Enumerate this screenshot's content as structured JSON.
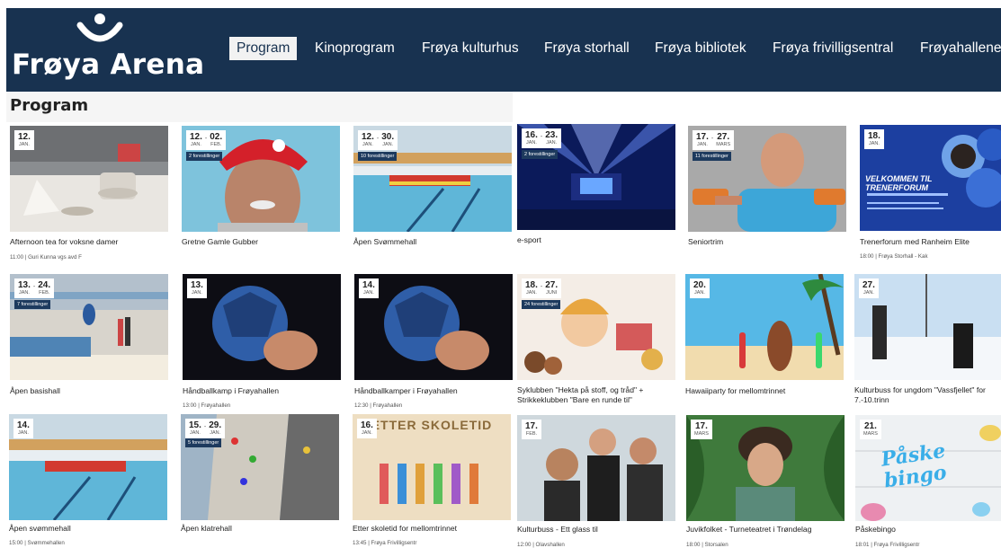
{
  "brand": {
    "name": "Frøya Arena"
  },
  "nav": {
    "items": [
      "Program",
      "Kinoprogram",
      "Frøya kulturhus",
      "Frøya storhall",
      "Frøya bibliotek",
      "Frøya frivilligsentral",
      "Frøyahallene"
    ],
    "active": "Program"
  },
  "page": {
    "title": "Program"
  },
  "colors": {
    "header": "#183250",
    "badge": "#1d3a5e"
  },
  "events": [
    {
      "d1": "12.",
      "m1": "JAN.",
      "title": "Afternoon tea for voksne damer",
      "meta": "11:00  |  Guri Kunna vgs avd F"
    },
    {
      "d1": "12.",
      "m1": "JAN.",
      "d2": "02.",
      "m2": "FEB.",
      "badge": "2 forestillinger",
      "title": "Gretne Gamle Gubber"
    },
    {
      "d1": "12.",
      "m1": "JAN.",
      "d2": "30.",
      "m2": "JAN.",
      "badge": "10 forestillinger",
      "title": "Åpen Svømmehall"
    },
    {
      "d1": "16.",
      "m1": "JAN.",
      "d2": "23.",
      "m2": "JAN.",
      "badge": "2 forestillinger",
      "title": "e-sport"
    },
    {
      "d1": "17.",
      "m1": "JAN.",
      "d2": "27.",
      "m2": "MARS",
      "badge": "11 forestillinger",
      "title": "Seniortrim"
    },
    {
      "d1": "18.",
      "m1": "JAN.",
      "title": "Trenerforum med Ranheim Elite",
      "meta": "18:00  |  Frøya Storhall - Kak",
      "poster": "VELKOMMEN TIL TRENERFORUM"
    },
    {
      "d1": "13.",
      "m1": "JAN.",
      "d2": "24.",
      "m2": "FEB.",
      "badge": "7 forestillinger",
      "title": "Åpen basishall"
    },
    {
      "d1": "13.",
      "m1": "JAN.",
      "title": "Håndballkamp i Frøyahallen",
      "meta": "13:00  |  Frøyahallen"
    },
    {
      "d1": "14.",
      "m1": "JAN.",
      "title": "Håndballkamper i Frøyahallen",
      "meta": "12:30  |  Frøyahallen"
    },
    {
      "d1": "18.",
      "m1": "JAN.",
      "d2": "27.",
      "m2": "JUNI",
      "badge": "24 forestillinger",
      "title": "Syklubben \"Hekta på stoff, og tråd\" + Strikkeklubben \"Bare en runde til\""
    },
    {
      "d1": "20.",
      "m1": "JAN.",
      "title": "Hawaiiparty for mellomtrinnet"
    },
    {
      "d1": "27.",
      "m1": "JAN.",
      "title": "Kulturbuss for ungdom \"Vassfjellet\" for 7.-10.trinn"
    },
    {
      "d1": "14.",
      "m1": "JAN.",
      "title": "Åpen svømmehall",
      "meta": "15:00  |  Svømmehallen"
    },
    {
      "d1": "15.",
      "m1": "JAN.",
      "d2": "29.",
      "m2": "JAN.",
      "badge": "5 forestillinger",
      "title": "Åpen klatrehall"
    },
    {
      "d1": "16.",
      "m1": "JAN.",
      "title": "Etter skoletid for mellomtrinnet",
      "meta": "13:45  |  Frøya Frivilligsentr",
      "poster": "ETTER SKOLETID"
    },
    {
      "d1": "17.",
      "m1": "FEB.",
      "title": "Kulturbuss - Ett glass til",
      "meta": "12:00  |  Olavshallen"
    },
    {
      "d1": "17.",
      "m1": "MARS",
      "title": "Juvikfolket - Turneteatret i Trøndelag",
      "meta": "18:00  |  Storsalen"
    },
    {
      "d1": "21.",
      "m1": "MARS",
      "title": "Påskebingo",
      "meta": "18:01  |  Frøya Frivilligsentr",
      "poster": "Påske bingo"
    }
  ]
}
